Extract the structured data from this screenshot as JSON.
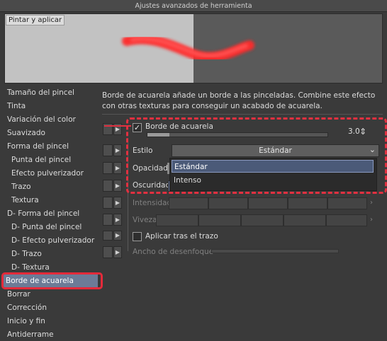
{
  "window": {
    "title": "Ajustes avanzados de herramienta"
  },
  "preview": {
    "label": "Pintar y aplicar"
  },
  "categories": [
    {
      "label": "Tamaño del pincel",
      "sub": false
    },
    {
      "label": "Tinta",
      "sub": false
    },
    {
      "label": "Variación del color",
      "sub": false
    },
    {
      "label": "Suavizado",
      "sub": false
    },
    {
      "label": "Forma del pincel",
      "sub": false
    },
    {
      "label": "Punta del pincel",
      "sub": true
    },
    {
      "label": "Efecto pulverizador",
      "sub": true
    },
    {
      "label": "Trazo",
      "sub": true
    },
    {
      "label": "Textura",
      "sub": true
    },
    {
      "label": "D- Forma del pincel",
      "sub": false
    },
    {
      "label": "D- Punta del pincel",
      "sub": true
    },
    {
      "label": "D- Efecto pulverizador",
      "sub": true
    },
    {
      "label": "D- Trazo",
      "sub": true
    },
    {
      "label": "D- Textura",
      "sub": true
    },
    {
      "label": "Borde de acuarela",
      "sub": false,
      "selected": true
    },
    {
      "label": "Borrar",
      "sub": false
    },
    {
      "label": "Corrección",
      "sub": false
    },
    {
      "label": "Inicio y fin",
      "sub": false
    },
    {
      "label": "Antiderrame",
      "sub": false
    }
  ],
  "description": "Borde de acuarela añade un borde a las pinceladas. Combine este efecto con otras texturas para conseguir un acabado de acuarela.",
  "settings": {
    "watercolor_edge": {
      "label": "Borde de acuarela",
      "checked": true,
      "value": "3.0",
      "fill_fraction": 0.12
    },
    "style": {
      "label": "Estilo",
      "selected": "Estándar",
      "options": [
        "Estándar",
        "Intenso"
      ]
    },
    "opacity": {
      "label": "Opacidad"
    },
    "darkness": {
      "label": "Oscuridad"
    },
    "intensity": {
      "label": "Intensidad"
    },
    "vividness": {
      "label": "Viveza"
    },
    "apply_after": {
      "label": "Aplicar tras el trazo",
      "checked": false
    },
    "blur_width": {
      "label": "Ancho de desenfoque"
    }
  },
  "colors": {
    "highlight": "#e23040",
    "selection": "#6c7b97",
    "menu_highlight": "#4b5a78"
  },
  "icons": {
    "check": "✓",
    "arrow_right": "▶",
    "chevron_down": "⌄",
    "spin": "⇕"
  }
}
